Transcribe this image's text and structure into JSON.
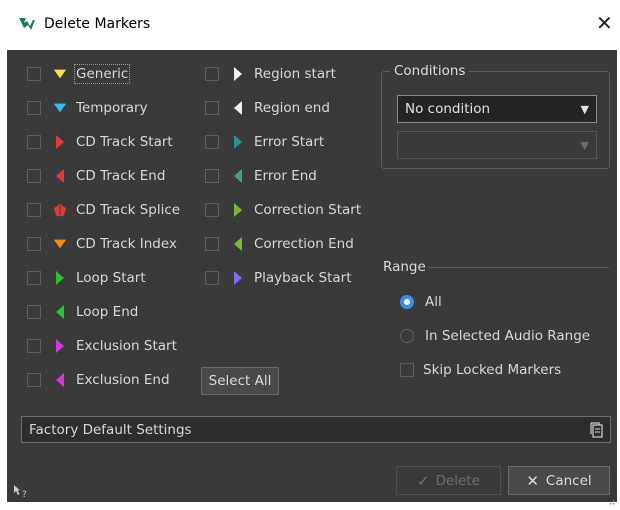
{
  "window": {
    "title": "Delete Markers",
    "close_glyph": "✕"
  },
  "markers_left": [
    {
      "label": "Generic",
      "icon": "generic-marker-icon",
      "color": "#f2e14a"
    },
    {
      "label": "Temporary",
      "icon": "temporary-marker-icon",
      "color": "#3ab8e8"
    },
    {
      "label": "CD Track Start",
      "icon": "cd-track-start-icon",
      "color": "#e03b3b"
    },
    {
      "label": "CD Track End",
      "icon": "cd-track-end-icon",
      "color": "#e03b3b"
    },
    {
      "label": "CD Track Splice",
      "icon": "cd-track-splice-icon",
      "color": "#e03b3b"
    },
    {
      "label": "CD Track Index",
      "icon": "cd-track-index-icon",
      "color": "#f08a1c"
    },
    {
      "label": "Loop Start",
      "icon": "loop-start-icon",
      "color": "#2fc22f"
    },
    {
      "label": "Loop End",
      "icon": "loop-end-icon",
      "color": "#2fc22f"
    },
    {
      "label": "Exclusion Start",
      "icon": "exclusion-start-icon",
      "color": "#d43bd4"
    },
    {
      "label": "Exclusion End",
      "icon": "exclusion-end-icon",
      "color": "#d43bd4"
    }
  ],
  "markers_right": [
    {
      "label": "Region start",
      "icon": "region-start-icon",
      "color": "#f2f2f2"
    },
    {
      "label": "Region end",
      "icon": "region-end-icon",
      "color": "#f2f2f2"
    },
    {
      "label": "Error Start",
      "icon": "error-start-icon",
      "color": "#2c8f9a"
    },
    {
      "label": "Error End",
      "icon": "error-end-icon",
      "color": "#4f9a8f"
    },
    {
      "label": "Correction Start",
      "icon": "correction-start-icon",
      "color": "#78b83a"
    },
    {
      "label": "Correction End",
      "icon": "correction-end-icon",
      "color": "#78b83a"
    },
    {
      "label": "Playback Start",
      "icon": "playback-start-icon",
      "color": "#7b6ef2"
    }
  ],
  "select_all_label": "Select All",
  "conditions": {
    "title": "Conditions",
    "selected": "No condition",
    "secondary_value": ""
  },
  "range": {
    "title": "Range",
    "options": [
      {
        "label": "All",
        "selected": true
      },
      {
        "label": "In Selected Audio Range",
        "selected": false
      }
    ],
    "skip_locked_label": "Skip Locked Markers"
  },
  "preset": {
    "value": "Factory Default Settings",
    "icon": "preset-menu-icon"
  },
  "buttons": {
    "delete_label": "Delete",
    "cancel_label": "Cancel"
  },
  "colors": {
    "dialog_bg": "#3a3a3a",
    "text": "#d8d8d8",
    "app_icon_green": "#1e7a4c",
    "radio_accent": "#3d8ee6"
  }
}
